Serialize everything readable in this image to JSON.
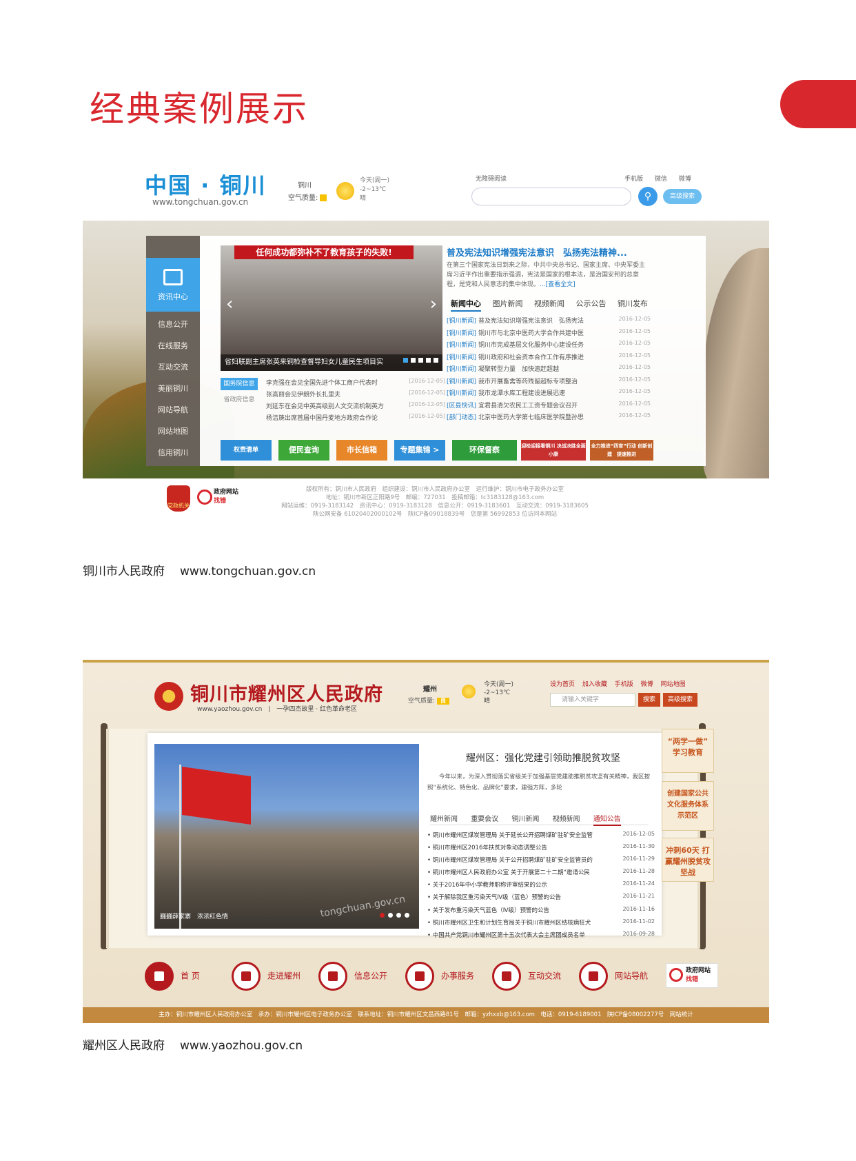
{
  "page": {
    "title": "经典案例展示",
    "accent": "#d9272e"
  },
  "site1": {
    "logo": "中国 · 铜川",
    "url": "www.tongchuan.gov.cn",
    "city": "铜川",
    "air_quality_label": "空气质量:",
    "weather_day": "今天(周一)",
    "weather_temp": "-2~13℃",
    "weather_desc": "晴",
    "accessibility": "无障碍阅读",
    "top_links": [
      "手机版",
      "微信",
      "微博"
    ],
    "search_placeholder": "",
    "advanced_search": "高级搜索",
    "sidebar": [
      "资讯中心",
      "信息公开",
      "在线服务",
      "互动交流",
      "美丽铜川",
      "网站导航",
      "网站地图",
      "信用铜川"
    ],
    "photo_banner": "任何成功都弥补不了教育孩子的失败!",
    "photo_caption": "省妇联副主席张英来铜检查督导妇女儿童民生项目实",
    "headline": "普及宪法知识增强宪法意识　弘扬宪法精神...",
    "summary": "在第三个国家宪法日到来之际，中共中央总书记、国家主席、中央军委主席习近平作出重要指示强调，宪法是国家的根本法，是治国安邦的总章程，是党和人民意志的集中体现。",
    "summary_link": "...[查看全文]",
    "tabs": [
      "新闻中心",
      "图片新闻",
      "视频新闻",
      "公示公告",
      "铜川发布"
    ],
    "news": [
      {
        "tag": "[铜川新闻]",
        "title": "普及宪法知识增强宪法意识　弘扬宪法",
        "date": "2016-12-05"
      },
      {
        "tag": "[铜川新闻]",
        "title": "铜川市与北京中医药大学合作共建中医",
        "date": "2016-12-05"
      },
      {
        "tag": "[铜川新闻]",
        "title": "铜川市完成基层文化服务中心建设任务",
        "date": "2016-12-05"
      },
      {
        "tag": "[铜川新闻]",
        "title": "铜川政府和社会资本合作工作有序推进",
        "date": "2016-12-05"
      },
      {
        "tag": "[铜川新闻]",
        "title": "凝聚转型力量　加快追赶超越",
        "date": "2016-12-05"
      },
      {
        "tag": "[铜川新闻]",
        "title": "我市开展畜禽等药残留超标专项整治",
        "date": "2016-12-05"
      },
      {
        "tag": "[铜川新闻]",
        "title": "我市龙潭水库工程建设进展迅速",
        "date": "2016-12-05"
      },
      {
        "tag": "[区县快讯]",
        "title": "宜君县清欠农民工工资专题会议召开",
        "date": "2016-12-05"
      },
      {
        "tag": "[部门动态]",
        "title": "北京中医药大学第七临床医学院暨孙思",
        "date": "2016-12-05"
      }
    ],
    "notice_tab_active": "国务院信息",
    "notice_tab_other": "省政府信息",
    "notices": [
      {
        "title": "李克强在会见全国先进个体工商户代表时",
        "date": "[2016-12-05]"
      },
      {
        "title": "张高丽会见伊朗外长扎里夫",
        "date": "[2016-12-05]"
      },
      {
        "title": "刘延东在会见中英高级别人文交流机制英方",
        "date": "[2016-12-05]"
      },
      {
        "title": "杨洁篪出席首届中国丹麦地方政府合作论",
        "date": "[2016-12-05]"
      }
    ],
    "quick_links": [
      "权责清单",
      "便民查询",
      "市长信箱",
      "专题集锦 >",
      "环保督察",
      "迎检迎接看铜川 决战决胜全面小康",
      "全力推进“四官”行动 创新创建　提速推进"
    ],
    "quick_colors": [
      "#2f8fd8",
      "#3da838",
      "#e8862a",
      "#2f8fd8",
      "#2e9c3a",
      "#c83030",
      "#c06028"
    ],
    "footer_emblem": "党政机关",
    "footer_gov": "政府网站",
    "footer_gov_sub": "找错",
    "footer_lines": [
      "版权所有：铜川市人民政府　组织建设：铜川市人民政府办公室　运行维护：铜川市电子政务办公室",
      "地址：铜川市新区正阳路9号　邮编：727031　投稿邮箱：tc3183128@163.com",
      "网站运维：0919-3183142　资讯中心：0919-3183128　信息公开：0919-3183601　互动交流：0919-3183605",
      "陕公网安备 61020402000102号　陕ICP备09018839号　您是第 56992853 位访问本网站"
    ]
  },
  "caption1": {
    "name": "铜川市人民政府",
    "url": "www.tongchuan.gov.cn"
  },
  "site2": {
    "title": "铜川市耀州区人民政府",
    "subtitle": "www.yaozhou.gov.cn　|　一孕四杰故里 · 红色革命老区",
    "city": "耀州",
    "air_quality_label": "空气质量:",
    "air_quality_value": "良",
    "weather_day": "今天(周一)",
    "weather_temp": "-2~13℃",
    "weather_desc": "晴",
    "top_links": [
      "设为首页",
      "加入收藏",
      "手机版",
      "微博",
      "网站地图"
    ],
    "search_placeholder": "请输入关键字",
    "search_button": "搜索",
    "advanced_search": "高级搜索",
    "photo_caption": "巍巍薛家寨　浓浓红色情",
    "watermark": "tongchuan.gov.cn",
    "headline": "耀州区：强化党建引领助推脱贫攻坚",
    "summary": "今年以来，为深入贯彻落实省级关于加强基层党建助推脱贫攻坚有关精神，我区按照“系统化、特色化、品牌化”要求，建强方阵，多轮",
    "tabs": [
      "耀州新闻",
      "重要会议",
      "铜川新闻",
      "视频新闻",
      "通知公告"
    ],
    "news": [
      {
        "title": "• 铜川市耀州区煤炭管理局 关于延长公开招聘煤矿驻矿安全监管",
        "date": "2016-12-05"
      },
      {
        "title": "• 铜川市耀州区2016年扶贫对象动态调整公告",
        "date": "2016-11-30"
      },
      {
        "title": "• 铜川市耀州区煤炭管理局 关于公开招聘煤矿驻矿安全监管员的",
        "date": "2016-11-29"
      },
      {
        "title": "• 铜川市耀州区人民政府办公室 关于开展第二十二期“邀请公民",
        "date": "2016-11-28"
      },
      {
        "title": "• 关于2016年中小学教师职称评审结果的公示",
        "date": "2016-11-24"
      },
      {
        "title": "• 关于解除我区重污染天气Ⅳ级（蓝色）预警的公告",
        "date": "2016-11-21"
      },
      {
        "title": "• 关于发布重污染天气蓝色（Ⅳ级）预警的公告",
        "date": "2016-11-16"
      },
      {
        "title": "• 铜川市耀州区卫生和计划生育局关于铜川市耀州区结核病狂犬",
        "date": "2016-11-02"
      },
      {
        "title": "• 中国共产党铜川市耀州区第十五次代表大会主席团成员名单",
        "date": "2016-09-28"
      }
    ],
    "side_boxes": [
      "“两学一做” 学习教育",
      "创建国家公共文化服务体系示范区",
      "冲刺60天 打赢耀州脱贫攻坚战"
    ],
    "nav": [
      "首 页",
      "走进耀州",
      "信息公开",
      "办事服务",
      "互动交流",
      "网站导航"
    ],
    "footer_gov": "政府网站",
    "footer_gov_sub": "找错",
    "footer": "主办：铜川市耀州区人民政府办公室　承办：铜川市耀州区电子政务办公室　联系地址：铜川市耀州区文昌西路81号　邮箱：yzhxxb@163.com　电话：0919-6189001　陕ICP备08002277号　网站统计"
  },
  "caption2": {
    "name": "耀州区人民政府",
    "url": "www.yaozhou.gov.cn"
  }
}
